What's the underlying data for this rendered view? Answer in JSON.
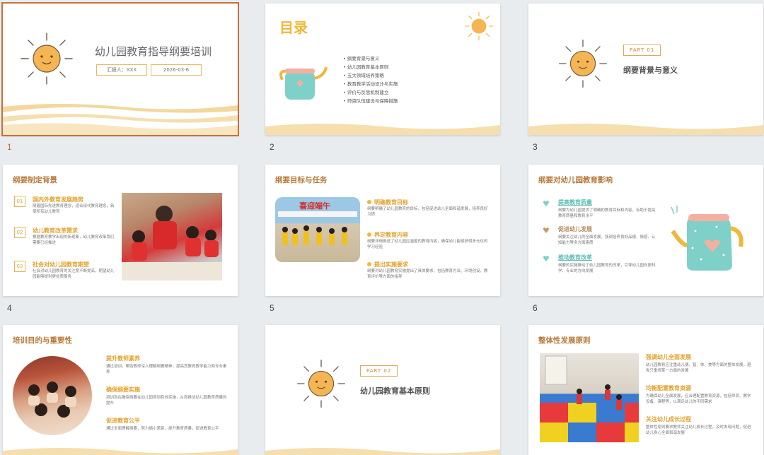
{
  "slides": [
    {
      "num": "1",
      "title": "幼儿园教育指导纲要培训",
      "reporter": "汇报人：XXX",
      "date": "2026-03-6"
    },
    {
      "num": "2",
      "title": "目录",
      "items": [
        "纲要背景与意义",
        "幼儿园教育基本原则",
        "五大领域培养策略",
        "教育教学活动设计与实施",
        "评价与反思机制建立",
        "师资队伍建设与保障措施"
      ]
    },
    {
      "num": "3",
      "part": "PART  01",
      "title": "纲要背景与意义"
    },
    {
      "num": "4",
      "title": "纲要制定背景",
      "points": [
        {
          "n": "01",
          "head": "国内外教育发展趋势",
          "body": "随着国际先进教育理念，适合现代教育理念，新使所有幼儿教育"
        },
        {
          "n": "02",
          "head": "幼儿教育改革需求",
          "body": "根据教育教学出现的新现象，幼儿教育改革我们需要已经推进"
        },
        {
          "n": "03",
          "head": "社会对幼儿园教育期望",
          "body": "社会对幼儿园教育的关注度不断提高，期望幼儿园能够提供更优质服务"
        }
      ]
    },
    {
      "num": "5",
      "title": "纲要目标与任务",
      "banner": "喜迎端午",
      "points": [
        {
          "head": "明确教育目标",
          "body": "纲要明确了幼儿园教育的目标，包括促进幼儿全面和谐发展，培养良好习惯"
        },
        {
          "head": "界定教育内容",
          "body": "纲要详细阐述了幼儿园应涵盖的教育内容，确保幼儿能够获得多元化的学习经验"
        },
        {
          "head": "提出实施要求",
          "body": "纲要对幼儿园教育实施提出了具体要求，包括教育方法、环境创设、教育评价等方面的指导"
        }
      ]
    },
    {
      "num": "6",
      "title": "纲要对幼儿园教育影响",
      "points": [
        {
          "head": "提高教育质量",
          "body": "纲要为幼儿园提供了明确的教育目标和内容，有助于提高教育质量和教育水平"
        },
        {
          "head": "促进幼儿发展",
          "body": "纲要关注幼儿的全面发展，强调培养良好品德、情感、认知能力等多方面素质"
        },
        {
          "head": "推动教育改革",
          "body": "纲要的实施推动了幼儿园教育的改革，引导幼儿园向更科学、专业的方向发展"
        }
      ]
    },
    {
      "num": "7",
      "title": "培训目的与重要性",
      "points": [
        {
          "head": "提升教师素养",
          "body": "通过培训，帮助教师深入理解纲要精神，提高其教育教学能力和专业素养"
        },
        {
          "head": "确保纲要实施",
          "body": "培训旨在确保纲要在幼儿园得到有效实施，从而推动幼儿园教育质量的提升"
        },
        {
          "head": "促进教育公平",
          "body": "通过全面理解纲要，努力缩小差距，提升教育质量，促进教育公平"
        }
      ]
    },
    {
      "num": "8",
      "part": "PART  02",
      "title": "幼儿园教育基本原则"
    },
    {
      "num": "9",
      "title": "整体性发展原则",
      "points": [
        {
          "head": "强调幼儿全面发展",
          "body": "幼儿园教育应注重幼儿德、智、体、美等方面的整体发展，避免只重视某一方面的发展"
        },
        {
          "head": "均衡配置教育资源",
          "body": "为确保幼儿全面发展，应合理配置教育资源，包括师资、教学设备、课程等，以满足幼儿的不同需求"
        },
        {
          "head": "关注幼儿成长过程",
          "body": "整体性原则要求教师关注幼儿成长过程，及时发现问题，促进幼儿身心全面和谐发展"
        }
      ]
    }
  ],
  "colors": {
    "accent": "#e3a12a",
    "title_brown": "#b87a3a",
    "selected_border": "#c6703a",
    "teal": "#7fd0c8"
  }
}
